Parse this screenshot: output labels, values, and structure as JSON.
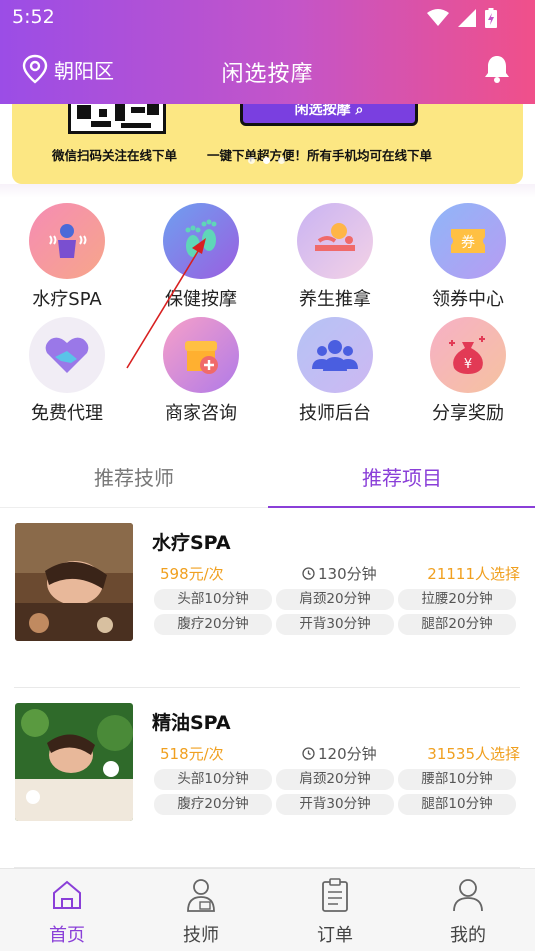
{
  "status_bar": {
    "time": "5:52"
  },
  "header": {
    "location": "朝阳区",
    "title": "闲选按摩"
  },
  "banner": {
    "button_label": "闲选按摩",
    "left_text": "微信扫码关注在线下单",
    "right_text": "一键下单超方便！所有手机均可在线下单",
    "dots": 3,
    "active_dot": 1
  },
  "grid": [
    {
      "label": "水疗SPA",
      "icon": "spa-icon"
    },
    {
      "label": "保健按摩",
      "icon": "footprint-icon"
    },
    {
      "label": "养生推拿",
      "icon": "massage-bed-icon"
    },
    {
      "label": "领券中心",
      "icon": "coupon-icon",
      "badge": "券"
    },
    {
      "label": "免费代理",
      "icon": "handshake-icon"
    },
    {
      "label": "商家咨询",
      "icon": "shop-icon"
    },
    {
      "label": "技师后台",
      "icon": "people-icon"
    },
    {
      "label": "分享奖励",
      "icon": "money-bag-icon",
      "badge": "¥"
    }
  ],
  "tabs": [
    {
      "label": "推荐技师",
      "active": false
    },
    {
      "label": "推荐项目",
      "active": true
    }
  ],
  "projects": [
    {
      "title": "水疗SPA",
      "price": "598元/次",
      "duration": "130分钟",
      "choose": "21111人选择",
      "tags": [
        "头部10分钟",
        "肩颈20分钟",
        "拉腰20分钟",
        "腹疗20分钟",
        "开背30分钟",
        "腿部20分钟"
      ]
    },
    {
      "title": "精油SPA",
      "price": "518元/次",
      "duration": "120分钟",
      "choose": "31535人选择",
      "tags": [
        "头部10分钟",
        "肩颈20分钟",
        "腰部10分钟",
        "腹疗20分钟",
        "开背30分钟",
        "腿部10分钟"
      ]
    }
  ],
  "tabbar": [
    {
      "label": "首页",
      "icon": "home-icon",
      "active": true
    },
    {
      "label": "技师",
      "icon": "technician-icon",
      "active": false
    },
    {
      "label": "订单",
      "icon": "order-icon",
      "active": false
    },
    {
      "label": "我的",
      "icon": "user-icon",
      "active": false
    }
  ],
  "colors": {
    "accent": "#8a3fd8",
    "header_start": "#9b4de6",
    "header_end": "#f0508a",
    "price": "#f0a020",
    "banner": "#fce783"
  }
}
